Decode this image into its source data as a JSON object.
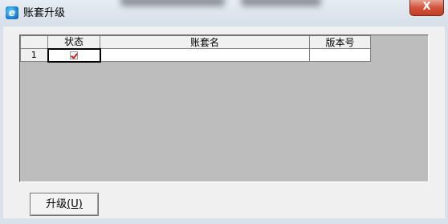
{
  "window": {
    "title": "账套升级",
    "app_icon_glyph": "e",
    "close_glyph": "X"
  },
  "grid": {
    "columns": [
      {
        "label": ""
      },
      {
        "label": "状态"
      },
      {
        "label": "账套名"
      },
      {
        "label": "版本号"
      }
    ],
    "rows": [
      {
        "number": "1",
        "status_checked": true,
        "name": "",
        "version": ""
      }
    ]
  },
  "buttons": {
    "upgrade": {
      "label": "升级",
      "accelerator": "(U)"
    }
  },
  "colors": {
    "grid_background": "#bdbdbd",
    "checkmark": "#cc1f1f"
  }
}
